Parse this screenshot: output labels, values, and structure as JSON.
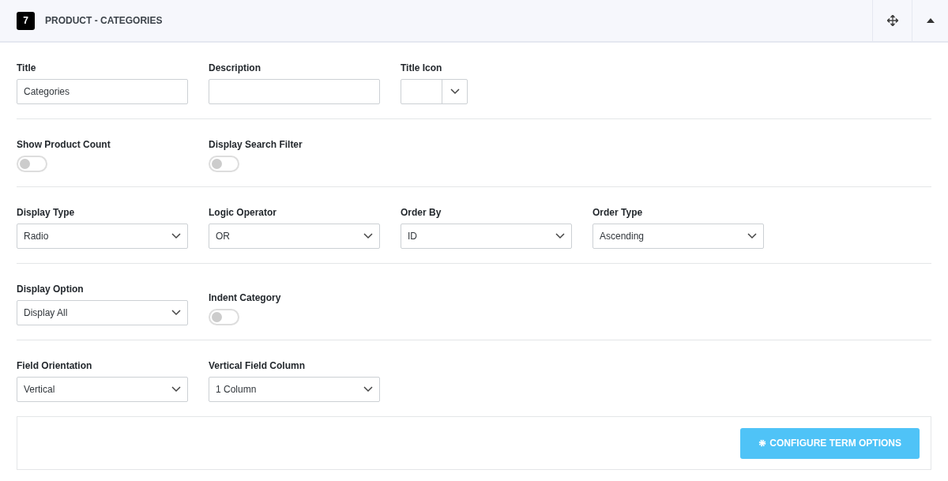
{
  "header": {
    "number": "7",
    "title": "PRODUCT - CATEGORIES"
  },
  "rows": [
    [
      {
        "kind": "text",
        "label": "Title",
        "value": "Categories"
      },
      {
        "kind": "text",
        "label": "Description"
      },
      {
        "kind": "iconselect",
        "label": "Title Icon"
      }
    ],
    [
      {
        "kind": "toggle",
        "label": "Show Product Count",
        "on": false
      },
      {
        "kind": "toggle",
        "label": "Display Search Filter",
        "on": false
      }
    ],
    [
      {
        "kind": "select",
        "label": "Display Type",
        "value": "Radio"
      },
      {
        "kind": "select",
        "label": "Logic Operator",
        "value": "OR"
      },
      {
        "kind": "select",
        "label": "Order By",
        "value": "ID"
      },
      {
        "kind": "select",
        "label": "Order Type",
        "value": "Ascending"
      }
    ],
    [
      {
        "kind": "select",
        "label": "Display Option",
        "value": "Display All"
      },
      {
        "kind": "toggle",
        "label": "Indent Category",
        "on": false
      }
    ],
    [
      {
        "kind": "select",
        "label": "Field Orientation",
        "value": "Vertical"
      },
      {
        "kind": "select",
        "label": "Vertical Field Column",
        "value": "1 Column"
      }
    ]
  ],
  "button": {
    "label": "CONFIGURE TERM OPTIONS"
  }
}
